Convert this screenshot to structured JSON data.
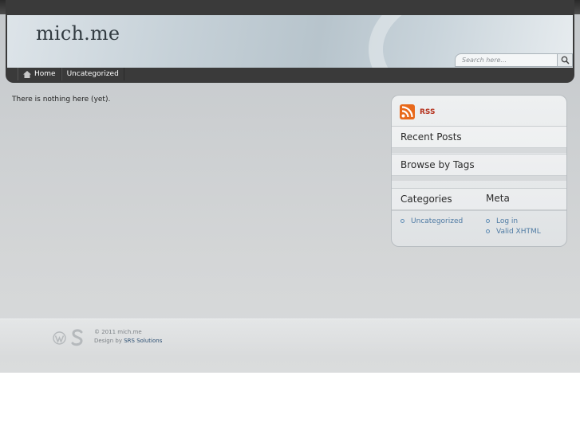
{
  "site": {
    "title": "mich.me"
  },
  "search": {
    "placeholder": "Search here..."
  },
  "nav": {
    "items": [
      {
        "label": "Home"
      },
      {
        "label": "Uncategorized"
      }
    ]
  },
  "main": {
    "message": "There is nothing here (yet)."
  },
  "sidebar": {
    "rss_label": "RSS",
    "recent_posts_title": "Recent Posts",
    "browse_tags_title": "Browse by Tags",
    "categories_title": "Categories",
    "categories": [
      "Uncategorized"
    ],
    "meta_title": "Meta",
    "meta": [
      "Log in",
      "Valid XHTML"
    ]
  },
  "footer": {
    "copyright": "© 2011 mich.me",
    "design_by": "Design by",
    "designer": "SRS Solutions"
  },
  "colors": {
    "accent_link": "#4e7aa3",
    "rss_orange": "#e8691b"
  }
}
